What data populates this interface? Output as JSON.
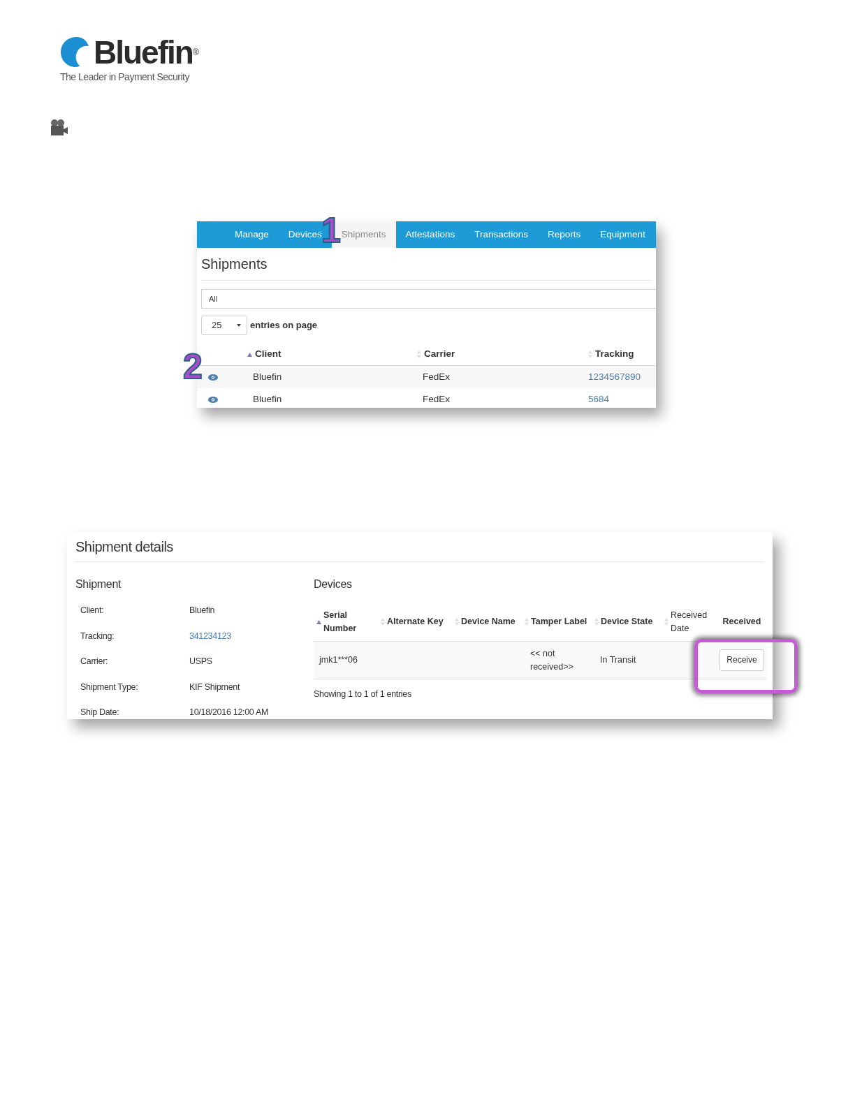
{
  "logo": {
    "wordmark": "Bluefin",
    "registered": "®",
    "tagline": "The Leader in Payment Security"
  },
  "shipments_screen": {
    "nav": [
      {
        "label": "Manage",
        "selected": false
      },
      {
        "label": "Devices",
        "selected": false
      },
      {
        "label": "Shipments",
        "selected": true
      },
      {
        "label": "Attestations",
        "selected": false
      },
      {
        "label": "Transactions",
        "selected": false
      },
      {
        "label": "Reports",
        "selected": false
      },
      {
        "label": "Equipment",
        "selected": false
      }
    ],
    "title": "Shipments",
    "filter": {
      "value": "All"
    },
    "page_size": {
      "value": "25",
      "label": "entries on page"
    },
    "columns": [
      {
        "label": "Client",
        "sorted": true
      },
      {
        "label": "Carrier",
        "sorted": false
      },
      {
        "label": "Tracking",
        "sorted": false
      }
    ],
    "rows": [
      {
        "client": "Bluefin",
        "carrier": "FedEx",
        "tracking": "1234567890"
      },
      {
        "client": "Bluefin",
        "carrier": "FedEx",
        "tracking": "5684"
      }
    ],
    "callouts": [
      "1",
      "2"
    ]
  },
  "details_screen": {
    "title": "Shipment details",
    "shipment": {
      "heading": "Shipment",
      "fields": [
        {
          "label": "Client:",
          "value": "Bluefin",
          "kind": "text"
        },
        {
          "label": "Tracking:",
          "value": "341234123",
          "kind": "link"
        },
        {
          "label": "Carrier:",
          "value": "USPS",
          "kind": "text"
        },
        {
          "label": "Shipment Type:",
          "value": "KIF Shipment",
          "kind": "text"
        },
        {
          "label": "Ship Date:",
          "value": "10/18/2016 12:00 AM",
          "kind": "text"
        }
      ]
    },
    "devices": {
      "heading": "Devices",
      "columns": [
        {
          "label": "Serial Number",
          "sorted": true
        },
        {
          "label": "Alternate Key",
          "sorted": false
        },
        {
          "label": "Device Name",
          "sorted": false
        },
        {
          "label": "Tamper Label",
          "sorted": false
        },
        {
          "label": "Device State",
          "sorted": false
        },
        {
          "label": "Received Date",
          "sorted": false
        },
        {
          "label": "Received"
        }
      ],
      "rows": [
        {
          "cells": [
            "jmk1***06",
            "",
            "",
            "<< not received>>",
            "In Transit",
            ""
          ],
          "action": "Receive",
          "highlighted": true
        }
      ],
      "footer": "Showing 1 to 1 of 1 entries"
    }
  }
}
